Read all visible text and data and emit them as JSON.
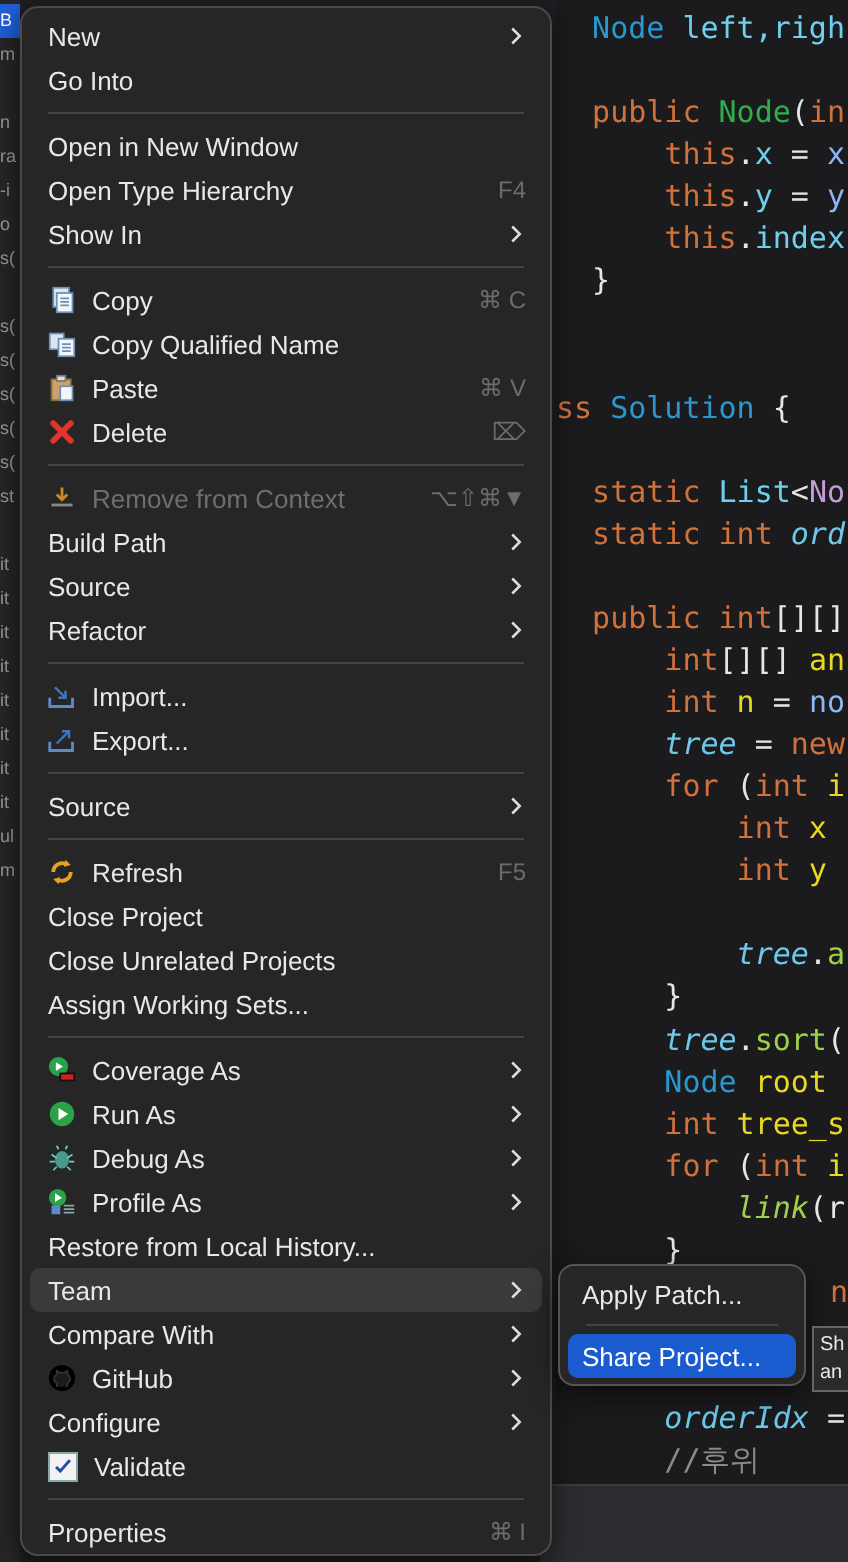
{
  "explorer": {
    "groups": [
      [
        {
          "label": "B",
          "selected": true
        },
        {
          "label": "m",
          "selected": false
        }
      ],
      [
        {
          "label": "n",
          "selected": false
        },
        {
          "label": "ra",
          "selected": false
        },
        {
          "label": "-i",
          "selected": false
        },
        {
          "label": "o",
          "selected": false
        },
        {
          "label": "s(",
          "selected": false
        }
      ],
      [
        {
          "label": "s(",
          "selected": false
        },
        {
          "label": "s(",
          "selected": false
        },
        {
          "label": "s(",
          "selected": false
        },
        {
          "label": "s(",
          "selected": false
        },
        {
          "label": "s(",
          "selected": false
        },
        {
          "label": "st",
          "selected": false
        }
      ],
      [
        {
          "label": "it",
          "selected": false
        },
        {
          "label": "it",
          "selected": false
        },
        {
          "label": "it",
          "selected": false
        },
        {
          "label": "it",
          "selected": false
        },
        {
          "label": "it",
          "selected": false
        },
        {
          "label": "it",
          "selected": false
        },
        {
          "label": "it",
          "selected": false
        },
        {
          "label": "it",
          "selected": false
        },
        {
          "label": "ul",
          "selected": false
        },
        {
          "label": "m",
          "selected": false
        }
      ]
    ]
  },
  "editor": {
    "lines": [
      {
        "kind": "code",
        "tokens": [
          {
            "text": "  Node",
            "kind": "type"
          },
          {
            "text": " left,righ",
            "kind": "field"
          }
        ]
      },
      {
        "kind": "blank"
      },
      {
        "kind": "code",
        "tokens": [
          {
            "text": "  public",
            "kind": "keyword"
          },
          {
            "text": " Node",
            "kind": "method"
          },
          {
            "text": "(",
            "kind": "plain"
          },
          {
            "text": "in",
            "kind": "keyword"
          }
        ]
      },
      {
        "kind": "code",
        "tokens": [
          {
            "text": "      this",
            "kind": "keyword"
          },
          {
            "text": ".",
            "kind": "plain"
          },
          {
            "text": "x",
            "kind": "field"
          },
          {
            "text": " = ",
            "kind": "plain"
          },
          {
            "text": "x",
            "kind": "param"
          }
        ]
      },
      {
        "kind": "code",
        "tokens": [
          {
            "text": "      this",
            "kind": "keyword"
          },
          {
            "text": ".",
            "kind": "plain"
          },
          {
            "text": "y",
            "kind": "field"
          },
          {
            "text": " = ",
            "kind": "plain"
          },
          {
            "text": "y",
            "kind": "param"
          }
        ]
      },
      {
        "kind": "code",
        "tokens": [
          {
            "text": "      this",
            "kind": "keyword"
          },
          {
            "text": ".",
            "kind": "plain"
          },
          {
            "text": "index",
            "kind": "field"
          }
        ]
      },
      {
        "kind": "code",
        "tokens": [
          {
            "text": "  }",
            "kind": "plain"
          }
        ]
      },
      {
        "kind": "blank"
      },
      {
        "kind": "blank"
      },
      {
        "kind": "code",
        "tokens": [
          {
            "text": "ss",
            "kind": "keyword"
          },
          {
            "text": " Solution",
            "kind": "type"
          },
          {
            "text": " {",
            "kind": "plain"
          }
        ]
      },
      {
        "kind": "blank"
      },
      {
        "kind": "code",
        "tokens": [
          {
            "text": "  static",
            "kind": "keyword"
          },
          {
            "text": " List",
            "kind": "field"
          },
          {
            "text": "<",
            "kind": "plain"
          },
          {
            "text": "No",
            "kind": "generic"
          }
        ]
      },
      {
        "kind": "code",
        "tokens": [
          {
            "text": "  static int",
            "kind": "keyword"
          },
          {
            "text": " ord",
            "kind": "static"
          }
        ]
      },
      {
        "kind": "blank"
      },
      {
        "kind": "code",
        "tokens": [
          {
            "text": "  public int",
            "kind": "keyword"
          },
          {
            "text": "[][]",
            "kind": "plain"
          }
        ]
      },
      {
        "kind": "code",
        "tokens": [
          {
            "text": "      int",
            "kind": "keyword"
          },
          {
            "text": "[][] ",
            "kind": "plain"
          },
          {
            "text": "an",
            "kind": "local"
          }
        ]
      },
      {
        "kind": "code",
        "tokens": [
          {
            "text": "      int",
            "kind": "keyword"
          },
          {
            "text": " n",
            "kind": "local"
          },
          {
            "text": " = ",
            "kind": "plain"
          },
          {
            "text": "no",
            "kind": "param"
          }
        ]
      },
      {
        "kind": "code",
        "tokens": [
          {
            "text": "      tree",
            "kind": "static"
          },
          {
            "text": " = ",
            "kind": "plain"
          },
          {
            "text": "new",
            "kind": "keyword"
          }
        ]
      },
      {
        "kind": "code",
        "tokens": [
          {
            "text": "      for",
            "kind": "keyword"
          },
          {
            "text": " (",
            "kind": "plain"
          },
          {
            "text": "int",
            "kind": "keyword"
          },
          {
            "text": " i",
            "kind": "local"
          }
        ]
      },
      {
        "kind": "code",
        "tokens": [
          {
            "text": "          int",
            "kind": "keyword"
          },
          {
            "text": " x",
            "kind": "local"
          }
        ]
      },
      {
        "kind": "code",
        "tokens": [
          {
            "text": "          int",
            "kind": "keyword"
          },
          {
            "text": " y",
            "kind": "local"
          }
        ]
      },
      {
        "kind": "blank"
      },
      {
        "kind": "code",
        "tokens": [
          {
            "text": "          tree",
            "kind": "static"
          },
          {
            "text": ".",
            "kind": "plain"
          },
          {
            "text": "a",
            "kind": "call"
          }
        ]
      },
      {
        "kind": "code",
        "tokens": [
          {
            "text": "      }",
            "kind": "plain"
          }
        ]
      },
      {
        "kind": "code",
        "tokens": [
          {
            "text": "      tree",
            "kind": "static"
          },
          {
            "text": ".",
            "kind": "plain"
          },
          {
            "text": "sort",
            "kind": "call"
          },
          {
            "text": "(",
            "kind": "plain"
          }
        ]
      },
      {
        "kind": "code",
        "tokens": [
          {
            "text": "      Node",
            "kind": "type"
          },
          {
            "text": " root",
            "kind": "local"
          }
        ]
      },
      {
        "kind": "code",
        "tokens": [
          {
            "text": "      int",
            "kind": "keyword"
          },
          {
            "text": " tree_s",
            "kind": "local"
          }
        ]
      },
      {
        "kind": "code",
        "tokens": [
          {
            "text": "      for",
            "kind": "keyword"
          },
          {
            "text": " (",
            "kind": "plain"
          },
          {
            "text": "int",
            "kind": "keyword"
          },
          {
            "text": " i",
            "kind": "local"
          }
        ]
      },
      {
        "kind": "code",
        "tokens": [
          {
            "text": "          link",
            "kind": "staticcall"
          },
          {
            "text": "(r",
            "kind": "plain"
          }
        ]
      },
      {
        "kind": "code",
        "tokens": [
          {
            "text": "      }",
            "kind": "plain"
          }
        ]
      },
      {
        "kind": "tail",
        "tokens": [
          {
            "text": "n",
            "kind": "keyword"
          }
        ]
      },
      {
        "kind": "blank"
      },
      {
        "kind": "blank"
      },
      {
        "kind": "code",
        "tokens": [
          {
            "text": "      orderIdx",
            "kind": "static"
          },
          {
            "text": " =",
            "kind": "plain"
          }
        ]
      },
      {
        "kind": "code",
        "tokens": [
          {
            "text": "      //후위",
            "kind": "comment"
          }
        ]
      }
    ]
  },
  "context_menu": {
    "items": [
      {
        "kind": "plain",
        "label": "New",
        "submenu": true,
        "selected": false
      },
      {
        "kind": "plain",
        "label": "Go Into",
        "selected": false
      },
      {
        "kind": "separator"
      },
      {
        "kind": "plain",
        "label": "Open in New Window",
        "selected": false
      },
      {
        "kind": "plain",
        "label": "Open Type Hierarchy",
        "shortcut": "F4",
        "selected": false
      },
      {
        "kind": "plain",
        "label": "Show In",
        "submenu": true,
        "selected": false
      },
      {
        "kind": "separator"
      },
      {
        "kind": "copy",
        "label": "Copy",
        "shortcut": "⌘ C",
        "selected": false
      },
      {
        "kind": "copyname",
        "label": "Copy Qualified Name",
        "selected": false
      },
      {
        "kind": "paste",
        "label": "Paste",
        "shortcut": "⌘ V",
        "selected": false
      },
      {
        "kind": "delete",
        "label": "Delete",
        "shortcut": "⌦",
        "selected": false
      },
      {
        "kind": "separator"
      },
      {
        "kind": "remove",
        "label": "Remove from Context",
        "shortcut": "⌥⇧⌘▼",
        "disabled": true,
        "selected": false
      },
      {
        "kind": "plain",
        "label": "Build Path",
        "submenu": true,
        "selected": false
      },
      {
        "kind": "plain",
        "label": "Source",
        "submenu": true,
        "selected": false
      },
      {
        "kind": "plain",
        "label": "Refactor",
        "submenu": true,
        "selected": false
      },
      {
        "kind": "separator"
      },
      {
        "kind": "import",
        "label": "Import...",
        "selected": false
      },
      {
        "kind": "export",
        "label": "Export...",
        "selected": false
      },
      {
        "kind": "separator"
      },
      {
        "kind": "plain",
        "label": "Source",
        "submenu": true,
        "selected": false
      },
      {
        "kind": "separator"
      },
      {
        "kind": "refresh",
        "label": "Refresh",
        "shortcut": "F5",
        "selected": false
      },
      {
        "kind": "plain",
        "label": "Close Project",
        "selected": false
      },
      {
        "kind": "plain",
        "label": "Close Unrelated Projects",
        "selected": false
      },
      {
        "kind": "plain",
        "label": "Assign Working Sets...",
        "selected": false
      },
      {
        "kind": "separator"
      },
      {
        "kind": "coverage",
        "label": "Coverage As",
        "submenu": true,
        "selected": false
      },
      {
        "kind": "run",
        "label": "Run As",
        "submenu": true,
        "selected": false
      },
      {
        "kind": "debug",
        "label": "Debug As",
        "submenu": true,
        "selected": false
      },
      {
        "kind": "profile",
        "label": "Profile As",
        "submenu": true,
        "selected": false
      },
      {
        "kind": "plain",
        "label": "Restore from Local History...",
        "selected": false
      },
      {
        "kind": "plain",
        "label": "Team",
        "submenu": true,
        "selected": true
      },
      {
        "kind": "plain",
        "label": "Compare With",
        "submenu": true,
        "selected": false
      },
      {
        "kind": "github",
        "label": "GitHub",
        "submenu": true,
        "selected": false
      },
      {
        "kind": "plain",
        "label": "Configure",
        "submenu": true,
        "selected": false
      },
      {
        "kind": "checkbox",
        "label": "Validate",
        "checked": true,
        "selected": false
      },
      {
        "kind": "separator"
      },
      {
        "kind": "plain",
        "label": "Properties",
        "shortcut": "⌘ I",
        "selected": false
      }
    ]
  },
  "submenu": {
    "items": [
      {
        "kind": "plain",
        "label": "Apply Patch...",
        "selected": false
      },
      {
        "kind": "separator"
      },
      {
        "kind": "plain",
        "label": "Share Project...",
        "selected": true
      }
    ]
  },
  "tooltip": {
    "lines": [
      "Sh",
      "an"
    ]
  }
}
